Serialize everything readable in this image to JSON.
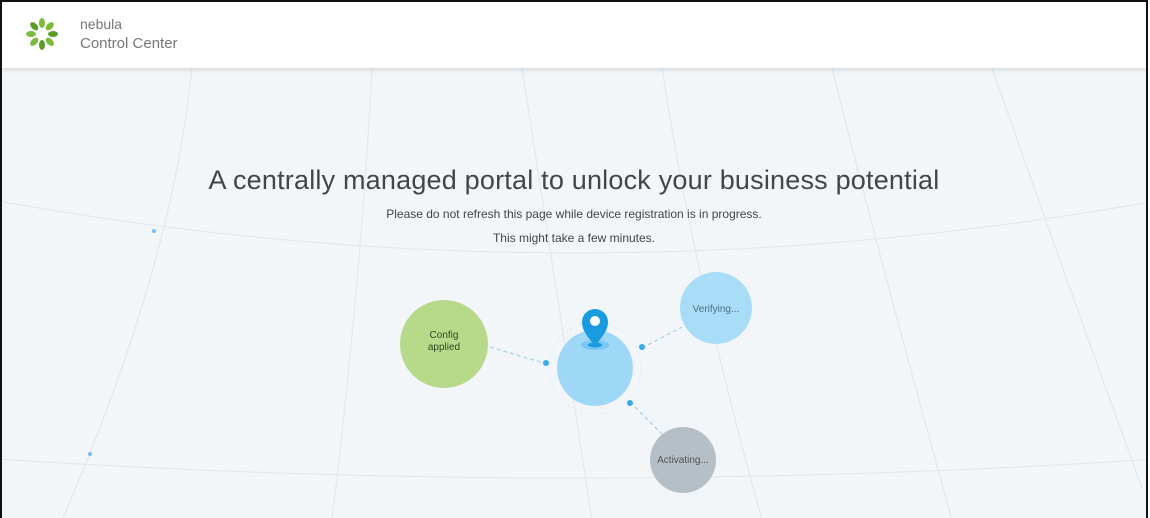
{
  "header": {
    "brand_name": "nebula",
    "product_name": "Control Center",
    "logo_icon": "nebula-leaf-icon",
    "logo_color": "#7dbb3c"
  },
  "main": {
    "headline": "A centrally managed portal to unlock your business potential",
    "notice_line1": "Please do not refresh this page while device registration is in progress.",
    "notice_line2": "This might take a few minutes."
  },
  "steps": [
    {
      "label": "Config applied",
      "state": "done",
      "color": "#b6d98a"
    },
    {
      "label": "Verifying...",
      "state": "in-progress",
      "color": "#a9dcf6"
    },
    {
      "label": "Activating...",
      "state": "pending",
      "color": "#b7bfc6"
    }
  ],
  "center_node": {
    "icon": "location-pin-icon",
    "color": "#9fd8f7",
    "pin_color": "#1a9be0"
  }
}
